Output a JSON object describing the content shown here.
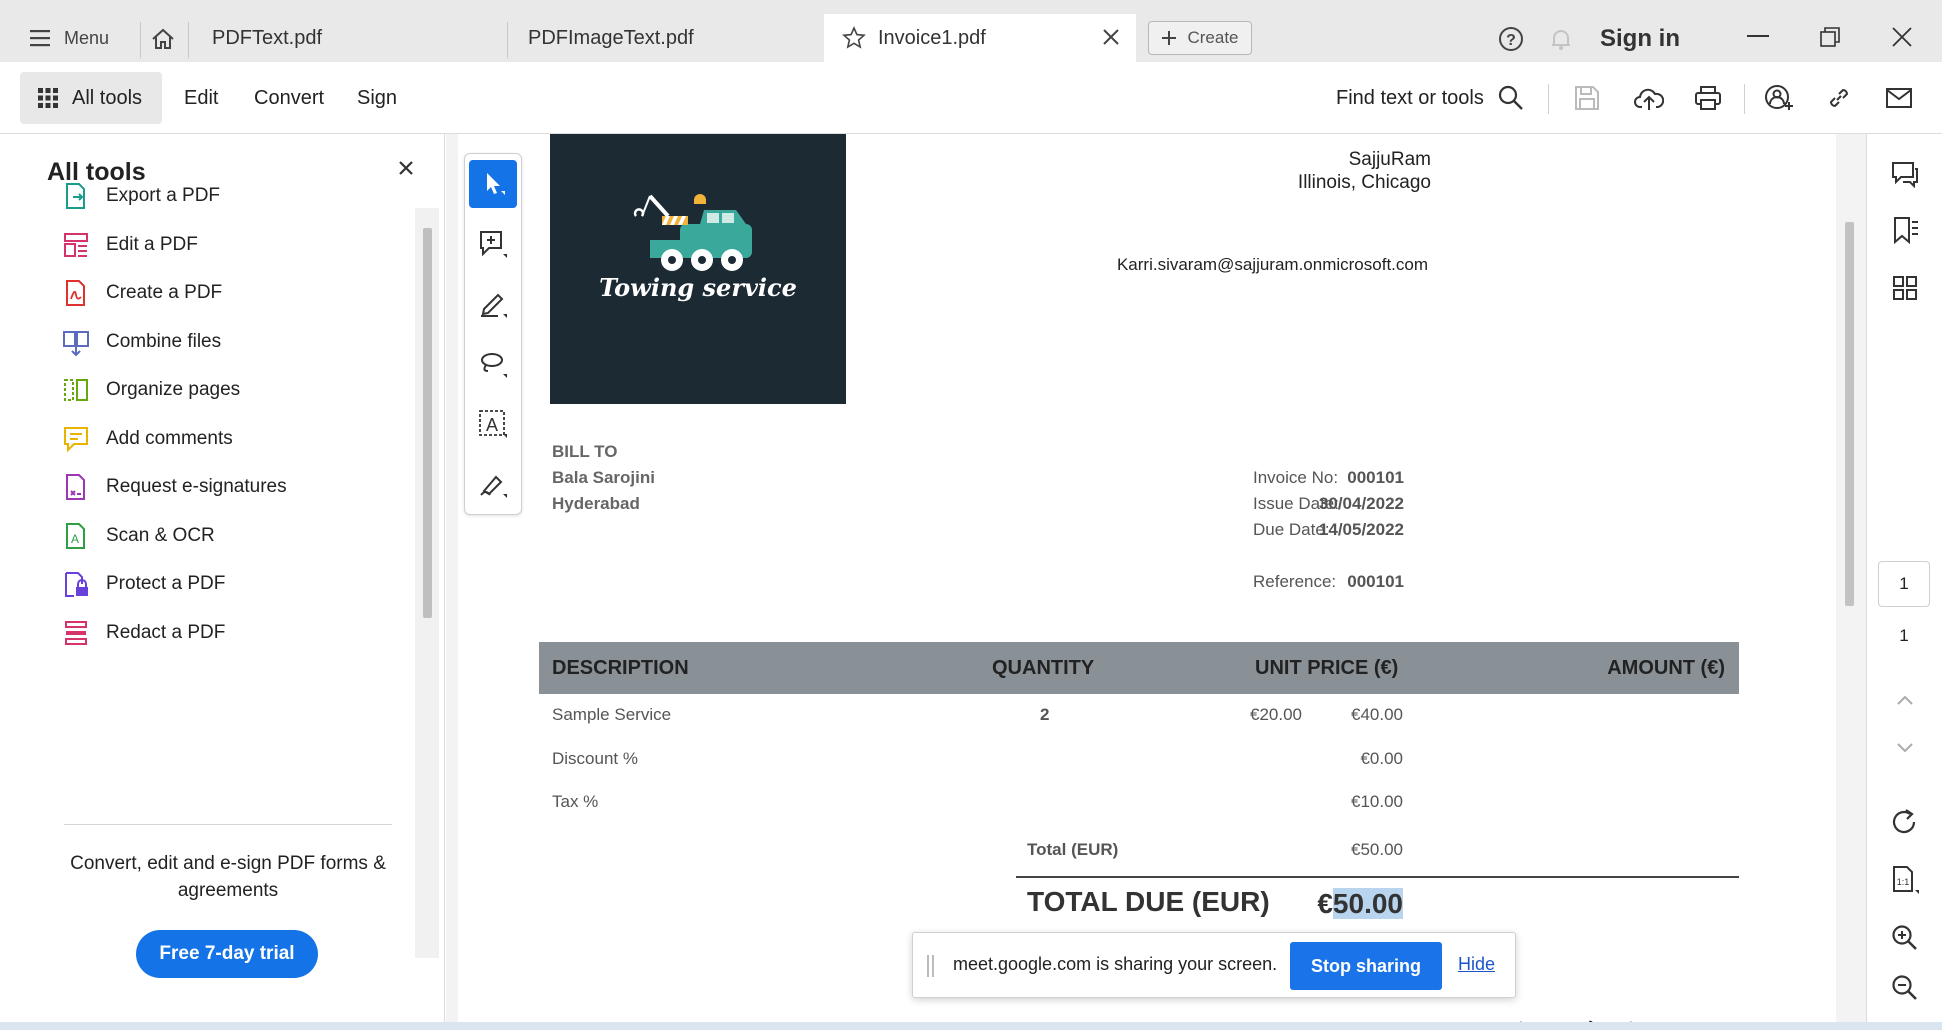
{
  "tabs": {
    "menu_label": "Menu",
    "items": [
      {
        "label": "PDFText.pdf"
      },
      {
        "label": "PDFImageText.pdf"
      },
      {
        "label": "Invoice1.pdf"
      }
    ],
    "create_label": "Create",
    "sign_in_label": "Sign in"
  },
  "toolbar": {
    "all_tools_label": "All tools",
    "menu": [
      "Edit",
      "Convert",
      "Sign"
    ],
    "find_label": "Find text or tools"
  },
  "left_panel": {
    "title": "All tools",
    "tools": [
      {
        "label": "Export a PDF",
        "icon": "export-pdf-icon",
        "color": "#1a9c8c"
      },
      {
        "label": "Edit a PDF",
        "icon": "edit-pdf-icon",
        "color": "#d6336c"
      },
      {
        "label": "Create a PDF",
        "icon": "create-pdf-icon",
        "color": "#e03131"
      },
      {
        "label": "Combine files",
        "icon": "combine-files-icon",
        "color": "#5c6bc0"
      },
      {
        "label": "Organize pages",
        "icon": "organize-pages-icon",
        "color": "#66a80f"
      },
      {
        "label": "Add comments",
        "icon": "add-comments-icon",
        "color": "#e8b400"
      },
      {
        "label": "Request e-signatures",
        "icon": "request-esignature-icon",
        "color": "#9c36b5"
      },
      {
        "label": "Scan & OCR",
        "icon": "scan-ocr-icon",
        "color": "#2f9e44"
      },
      {
        "label": "Protect a PDF",
        "icon": "protect-pdf-icon",
        "color": "#6741d9"
      },
      {
        "label": "Redact a PDF",
        "icon": "redact-pdf-icon",
        "color": "#d6336c"
      }
    ],
    "promo_text": "Convert, edit and e-sign PDF forms & agreements",
    "trial_button": "Free 7-day trial"
  },
  "invoice": {
    "logo_text": "Towing service",
    "company_name": "SajjuRam",
    "company_location": "Illinois, Chicago",
    "company_email": "Karri.sivaram@sajjuram.onmicrosoft.com",
    "bill_to_heading": "BILL TO",
    "bill_to_name": "Bala Sarojini",
    "bill_to_city": "Hyderabad",
    "meta": [
      {
        "label": "Invoice No:",
        "value": "000101"
      },
      {
        "label": "Issue Date:",
        "value": "30/04/2022"
      },
      {
        "label": "Due Date:",
        "value": "14/05/2022"
      },
      {
        "label": "Reference:",
        "value": "000101"
      }
    ],
    "table_headers": [
      "DESCRIPTION",
      "QUANTITY",
      "UNIT PRICE (€)",
      "AMOUNT (€)"
    ],
    "rows": [
      {
        "description": "Sample Service",
        "quantity": "2",
        "unit_price": "€20.00",
        "amount": "€40.00"
      },
      {
        "description": "Discount %",
        "quantity": "",
        "unit_price": "",
        "amount": "€0.00"
      },
      {
        "description": "Tax %",
        "quantity": "",
        "unit_price": "",
        "amount": "€10.00"
      }
    ],
    "total_label": "Total (EUR)",
    "total_value": "€50.00",
    "total_due_label": "TOTAL DUE (EUR)",
    "total_due_currency": "€",
    "total_due_amount": "50.00",
    "header_bg": "#8a9196",
    "logo_bg": "#1b2a33"
  },
  "right_rail": {
    "page_current": "1",
    "page_total": "1"
  },
  "share_banner": {
    "message": "meet.google.com is sharing your screen.",
    "stop_label": "Stop sharing",
    "hide_label": "Hide"
  }
}
